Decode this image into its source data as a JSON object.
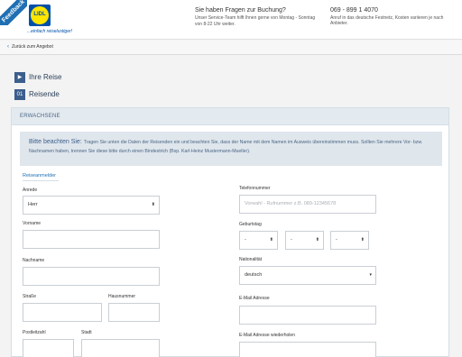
{
  "feedback": {
    "label": "Feedback"
  },
  "header": {
    "logo_text": "LIDL",
    "slogan": "...einfach reiselustiger!",
    "help_title": "Sie haben Fragen zur Buchung?",
    "help_text": "Unser Service-Team hilft Ihnen gerne von Montag - Sonntag von 8-22 Uhr weiter.",
    "phone": "069 - 899 1 4070",
    "phone_note": "Anruf in das deutsche Festnetz, Kosten variieren je nach Anbieter."
  },
  "backbar": {
    "label": "Zurück zum Angebot"
  },
  "steps": [
    {
      "badge": "▶",
      "label": "Ihre Reise"
    },
    {
      "badge": "01",
      "label": "Reisende"
    }
  ],
  "section": {
    "title": "ERWACHSENE",
    "notice_strong": "Bitte beachten Sie:",
    "notice_text": "Tragen Sie unten die Daten der Reisenden ein und beachten Sie, dass der Name mit dem Namen im Ausweis übereinstimmen muss. Sollten Sie mehrere Vor- bzw. Nachnamen haben, trennen Sie diese bitte durch einen Bindestrich (Bsp. Karl-Heinz Mustermann-Mueller).",
    "sub_head": "Reiseanmelder"
  },
  "form": {
    "anrede_label": "Anrede",
    "anrede_value": "Herr",
    "vorname_label": "Vorname",
    "nachname_label": "Nachname",
    "strasse_label": "Straße",
    "hausnummer_label": "Hausnummer",
    "plz_label": "Postleitzahl",
    "stadt_label": "Stadt",
    "telefon_label": "Telefonnummer",
    "telefon_placeholder": "Vorwahl - Rufnummer z.B. 089-12345678",
    "geburtstag_label": "Geburtstag",
    "geburtstag_day": "-",
    "geburtstag_month": "-",
    "geburtstag_year": "-",
    "nationalitaet_label": "Nationalität",
    "nationalitaet_value": "deutsch",
    "email_label": "E-Mail Adresse",
    "email_repeat_label": "E-Mail Adresse wiederholen"
  },
  "icons": {
    "back": "chevron-left-icon",
    "select": "chevron-down-icon"
  },
  "colors": {
    "brand_blue": "#0050aa",
    "accent": "#3b5e8c",
    "notice_bg": "#dfe6ec"
  }
}
